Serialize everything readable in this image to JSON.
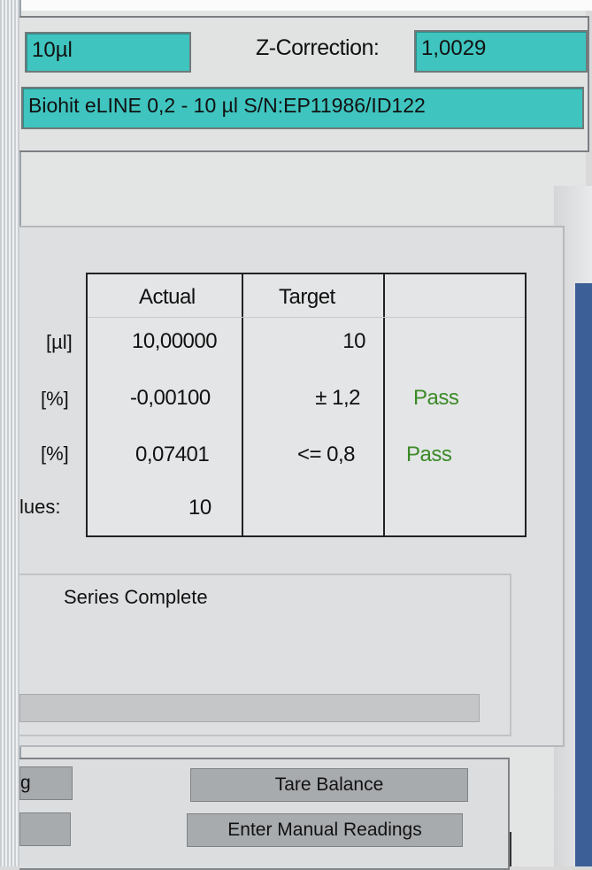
{
  "header": {
    "volume_value": "10µl",
    "z_correction_label": "Z-Correction:",
    "z_correction_value": "1,0029",
    "pipette_description": "Biohit eLINE 0,2 - 10 µl S/N:EP11986/ID122"
  },
  "results": {
    "columns": [
      "Actual",
      "Target",
      ""
    ],
    "rows": [
      {
        "label": "[µl]",
        "actual": "10,00000",
        "target": "10",
        "result": ""
      },
      {
        "label": "[%]",
        "actual": "-0,00100",
        "target": "± 1,2",
        "result": "Pass"
      },
      {
        "label": "[%]",
        "actual": "0,07401",
        "target": "<= 0,8",
        "result": "Pass"
      },
      {
        "label": "lues:",
        "actual": "10",
        "target": "",
        "result": ""
      }
    ]
  },
  "status": {
    "message": "Series Complete"
  },
  "buttons": {
    "left_1": "g",
    "left_2": "",
    "tare": "Tare Balance",
    "manual": "Enter Manual Readings"
  },
  "colors": {
    "field_teal": "#3fc4bf",
    "pass_green": "#3b8a27",
    "button_gray": "#a8abae"
  }
}
